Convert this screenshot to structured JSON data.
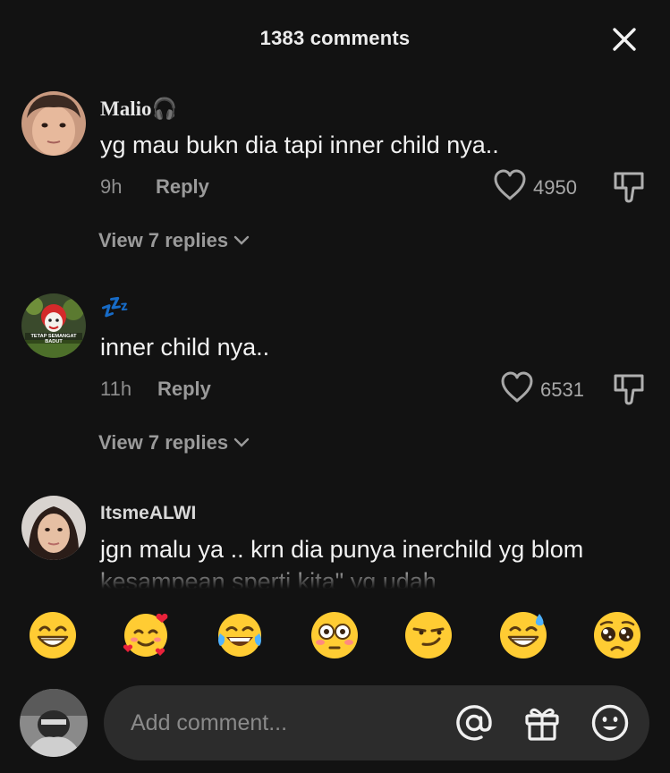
{
  "header": {
    "title": "1383 comments",
    "close_icon": "close-icon"
  },
  "comments": [
    {
      "username": "Malio🎧",
      "text": "yg mau bukn dia tapi inner child nya..",
      "time": "9h",
      "reply_label": "Reply",
      "likes": "4950",
      "view_replies": "View 7 replies"
    },
    {
      "username": "💤",
      "text": "inner child nya..",
      "time": "11h",
      "reply_label": "Reply",
      "likes": "6531",
      "view_replies": "View 7 replies",
      "avatar_text": "TETAP SEMANGAT BADUT"
    },
    {
      "username": "ItsmeALWI",
      "text": "jgn malu ya .. krn dia punya inerchild yg blom kesampean sperti kita\" yg udah"
    }
  ],
  "emojis": [
    "😁",
    "🥰",
    "😂",
    "😳",
    "😏",
    "😅",
    "🥺"
  ],
  "input": {
    "placeholder": "Add comment...",
    "icons": [
      "at-icon",
      "gift-icon",
      "emoji-icon"
    ]
  },
  "colors": {
    "background": "#121212",
    "input_background": "#2c2c2c",
    "muted_text": "#8e8e8e"
  }
}
